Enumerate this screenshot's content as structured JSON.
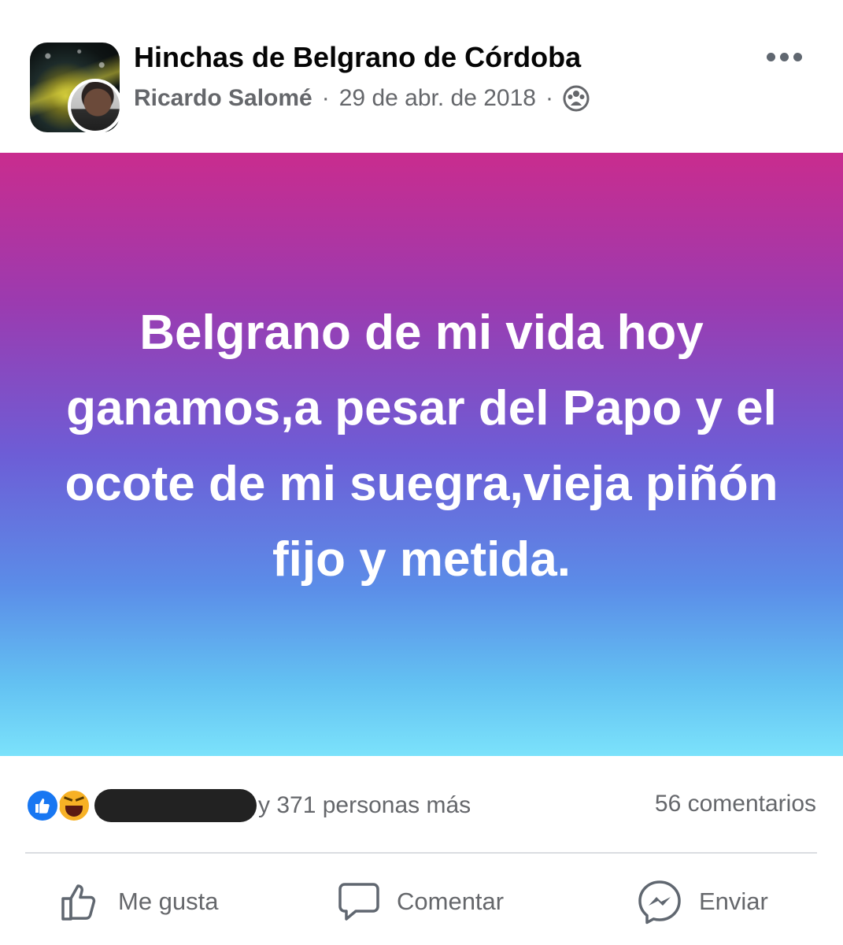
{
  "post": {
    "group_name": "Hinchas de Belgrano de Córdoba",
    "author": "Ricardo Salomé",
    "separator": "·",
    "date": "29 de abr. de 2018",
    "privacy_icon": "group-icon",
    "text": "Belgrano de mi vida hoy ganamos,a pesar del Papo y el ocote de mi suegra,vieja piñón fijo y metida.",
    "background_gradient": [
      "#c92c8e",
      "#6d5dd6",
      "#7be2fb"
    ]
  },
  "reactions": {
    "icons": [
      "like-icon",
      "haha-icon"
    ],
    "summary": "y 371 personas más",
    "comments": "56 comentarios",
    "like_color": "#1877f2"
  },
  "actions": {
    "like": "Me gusta",
    "comment": "Comentar",
    "send": "Enviar"
  }
}
